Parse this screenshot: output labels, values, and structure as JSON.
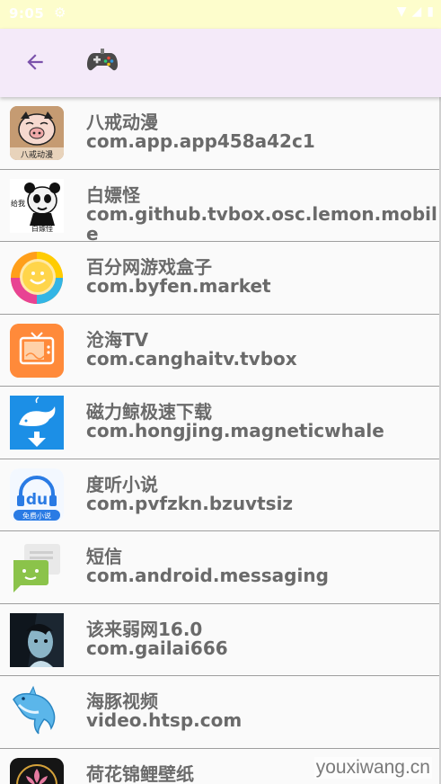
{
  "status_bar": {
    "time": "9:05",
    "icons": [
      "settings-icon",
      "wifi-icon",
      "signal-icon",
      "battery-icon"
    ]
  },
  "app_bar": {
    "back_icon": "arrow-back-icon",
    "title_icon": "gamepad-icon"
  },
  "apps": [
    {
      "name": "八戒动漫",
      "package": "com.app.app458a42c1",
      "icon": "pig-cartoon-icon"
    },
    {
      "name": "白嫖怪",
      "package": "com.github.tvbox.osc.lemon.mobile",
      "icon": "panda-meme-icon"
    },
    {
      "name": "百分网游戏盒子",
      "package": "com.byfen.market",
      "icon": "smiley-ring-icon"
    },
    {
      "name": "沧海TV",
      "package": "com.canghaitv.tvbox",
      "icon": "tv-icon"
    },
    {
      "name": "磁力鲸极速下载",
      "package": "com.hongjing.magneticwhale",
      "icon": "whale-download-icon"
    },
    {
      "name": "度听小说",
      "package": "com.pvfzkn.bzuvtsiz",
      "icon": "du-headphones-icon"
    },
    {
      "name": "短信",
      "package": "com.android.messaging",
      "icon": "messaging-icon"
    },
    {
      "name": "该来弱网16.0",
      "package": "com.gailai666",
      "icon": "portrait-icon"
    },
    {
      "name": "海豚视频",
      "package": "video.htsp.com",
      "icon": "dolphin-icon"
    },
    {
      "name": "荷花锦鲤壁纸",
      "package": "",
      "icon": "lotus-koi-icon"
    }
  ],
  "icon_labels": {
    "pig": "八戒动漫",
    "panda_top": "给我",
    "panda_bottom": "白嫖怪",
    "du": "du",
    "du_caption": "免费小说"
  },
  "watermark": "youxiwang.cn",
  "colors": {
    "accent": "#7b52ab",
    "app_bar_bg": "#f4eaf9",
    "status_bar_bg": "#fdfdcc",
    "divider": "#9e9e9e",
    "text": "#6a6a6a"
  }
}
